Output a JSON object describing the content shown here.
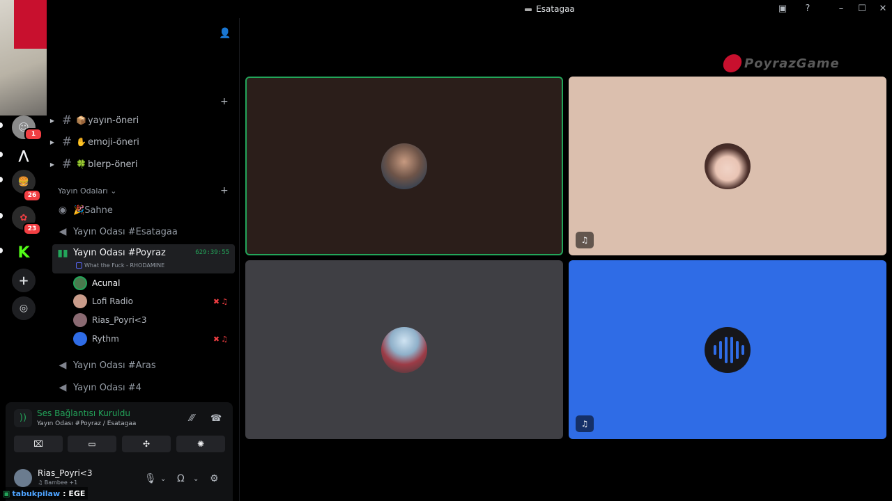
{
  "window": {
    "title": "Esatagaa"
  },
  "titlebar_icons": [
    "inbox-icon",
    "help-icon",
    "minimize-icon",
    "maximize-icon",
    "close-icon"
  ],
  "servers": [
    {
      "name": "server-1",
      "badge": "1"
    },
    {
      "name": "server-2",
      "badge": ""
    },
    {
      "name": "server-3",
      "badge": "26"
    },
    {
      "name": "server-4",
      "badge": "23"
    },
    {
      "name": "kick",
      "badge": ""
    }
  ],
  "text_channels": [
    {
      "emoji": "📦",
      "name": "yayın-öneri"
    },
    {
      "emoji": "✋",
      "name": "emoji-öneri"
    },
    {
      "emoji": "🍀",
      "name": "blerp-öneri"
    }
  ],
  "category": {
    "name": "Yayın Odaları"
  },
  "voice_channels": {
    "stage": {
      "emoji": "🎉",
      "name": "Sahne"
    },
    "esatagaa": {
      "name": "Yayın Odası #Esatagaa"
    },
    "poyraz": {
      "name": "Yayın Odası #Poyraz",
      "timer": "629:39:55",
      "activity": "What the Fuck - RHODAMINE"
    },
    "aras": {
      "name": "Yayın Odası #Aras"
    },
    "four": {
      "name": "Yayın Odası #4"
    }
  },
  "members": [
    {
      "name": "Acunal"
    },
    {
      "name": "Lofi Radio"
    },
    {
      "name": "Rias_Poyri<3"
    },
    {
      "name": "Rythm"
    }
  ],
  "voice_panel": {
    "status": "Ses Bağlantısı Kuruldu",
    "location": "Yayın Odası #Poyraz / Esatagaa"
  },
  "user_panel": {
    "name": "Rias_Poyri<3",
    "activity": "Bambee +1"
  },
  "ticker": {
    "name": "tabukpilaw",
    "text": ": EGE"
  },
  "stage_logo": {
    "text": "PoyrazGame"
  },
  "colors": {
    "speaking": "#23a55a",
    "accent": "#5865f2",
    "rythm_tile": "#2f6ce6",
    "danger": "#f23f43"
  }
}
